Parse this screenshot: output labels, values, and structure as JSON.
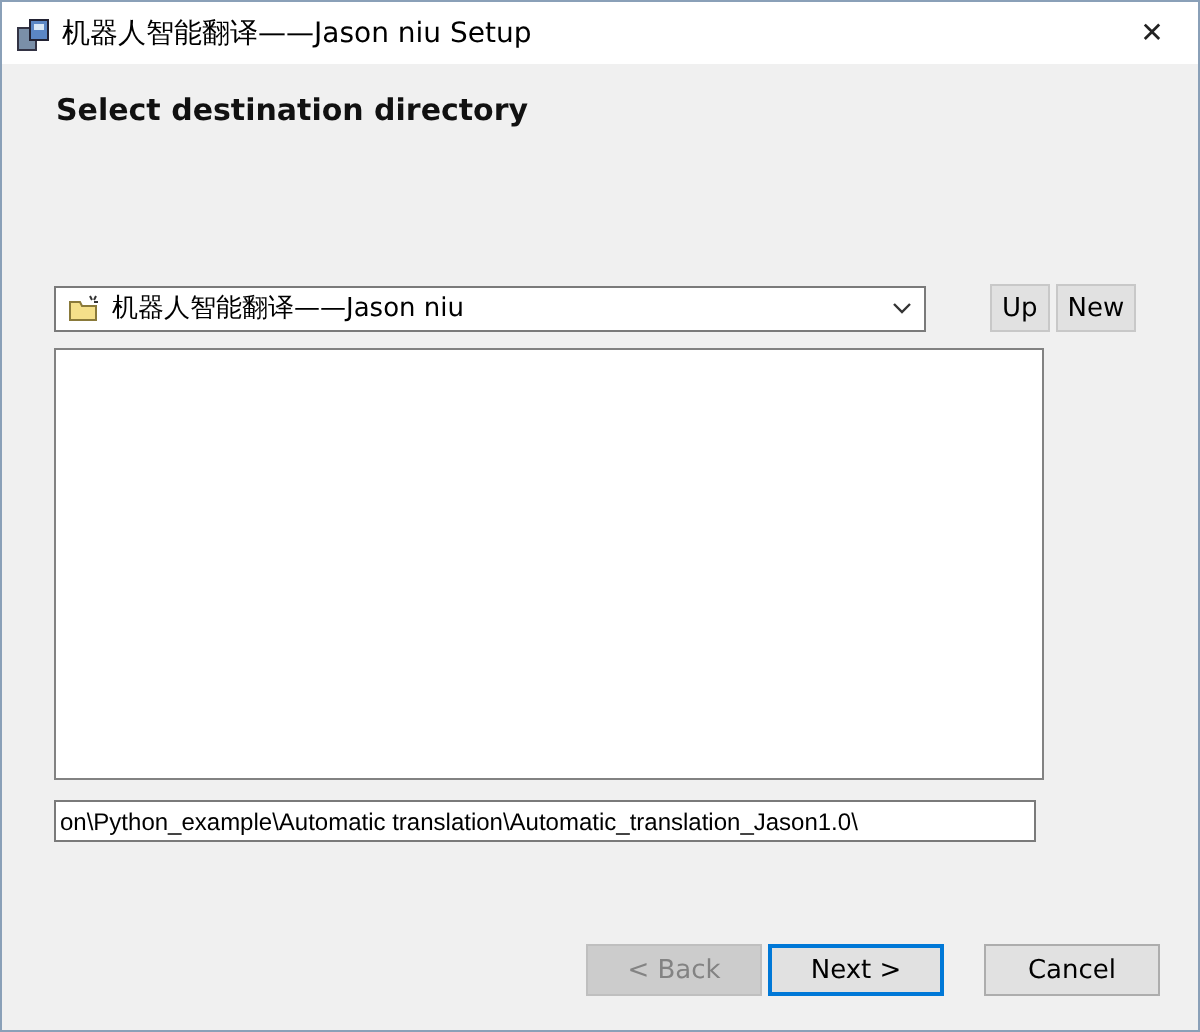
{
  "window": {
    "title": "机器人智能翻译——Jason niu Setup",
    "close": "✕"
  },
  "heading": "Select destination directory",
  "folder_combo": {
    "value": "机器人智能翻译——Jason niu"
  },
  "nav_buttons": [
    {
      "label": "Up"
    },
    {
      "label": "New"
    }
  ],
  "path_field": {
    "value": "on\\Python_example\\Automatic translation\\Automatic_translation_Jason1.0\\"
  },
  "buttons": [
    {
      "label": "< Back",
      "disabled": true,
      "default": false
    },
    {
      "label": "Next >",
      "disabled": false,
      "default": true
    },
    {
      "label": "Cancel",
      "disabled": false,
      "default": false
    }
  ]
}
